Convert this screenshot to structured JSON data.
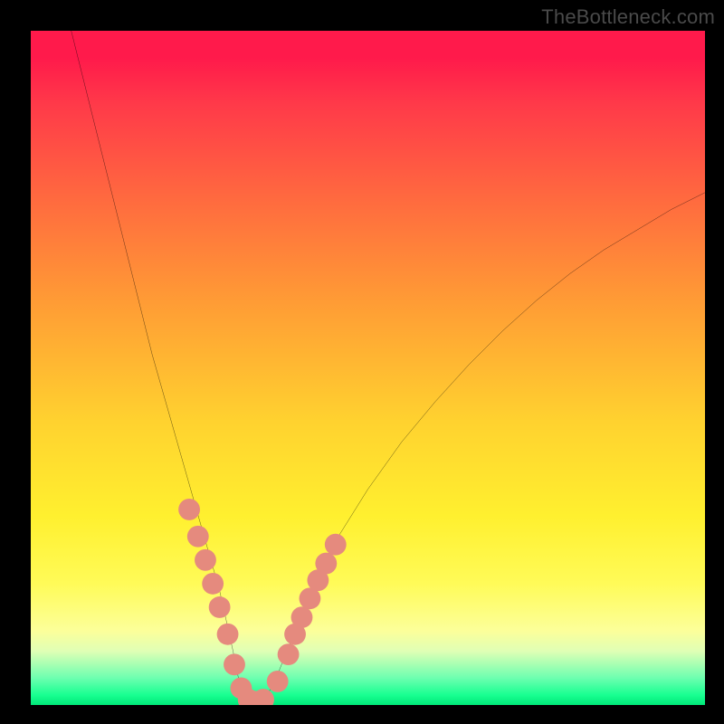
{
  "watermark": "TheBottleneck.com",
  "chart_data": {
    "type": "line",
    "title": "",
    "xlabel": "",
    "ylabel": "",
    "xlim": [
      0,
      100
    ],
    "ylim": [
      0,
      100
    ],
    "grid": false,
    "series": [
      {
        "name": "curve",
        "x": [
          6,
          8,
          10,
          12,
          14,
          16,
          18,
          20,
          22,
          24,
          26,
          28,
          30,
          31,
          32,
          34,
          36,
          38,
          40,
          42,
          45,
          50,
          55,
          60,
          65,
          70,
          75,
          80,
          85,
          90,
          95,
          100
        ],
        "y": [
          100,
          92,
          84,
          76,
          68,
          60,
          52,
          45,
          38,
          31,
          24,
          17,
          8,
          3,
          0,
          0,
          3,
          8,
          13,
          18,
          24,
          32,
          39,
          45,
          50.5,
          55.5,
          60,
          64,
          67.5,
          70.5,
          73.5,
          76
        ],
        "color": "#000000"
      },
      {
        "name": "dots",
        "x": [
          23.5,
          24.8,
          25.9,
          27.0,
          28.0,
          29.2,
          30.2,
          31.2,
          32.3,
          33.2,
          34.5,
          36.6,
          38.2,
          39.2,
          40.2,
          41.4,
          42.6,
          43.8,
          45.2
        ],
        "y": [
          29.0,
          25.0,
          21.5,
          18.0,
          14.5,
          10.5,
          6.0,
          2.5,
          0.8,
          0.5,
          0.8,
          3.5,
          7.5,
          10.5,
          13.0,
          15.8,
          18.5,
          21.0,
          23.8
        ],
        "color": "#e58a7e",
        "marker_r": 1.6
      }
    ],
    "background": {
      "type": "vertical-gradient",
      "stops": [
        {
          "pos": 0,
          "color": "#ff1a4b"
        },
        {
          "pos": 0.25,
          "color": "#ff6a3f"
        },
        {
          "pos": 0.58,
          "color": "#ffd22f"
        },
        {
          "pos": 0.82,
          "color": "#fffb58"
        },
        {
          "pos": 0.96,
          "color": "#6dffb0"
        },
        {
          "pos": 1.0,
          "color": "#00e879"
        }
      ]
    }
  }
}
